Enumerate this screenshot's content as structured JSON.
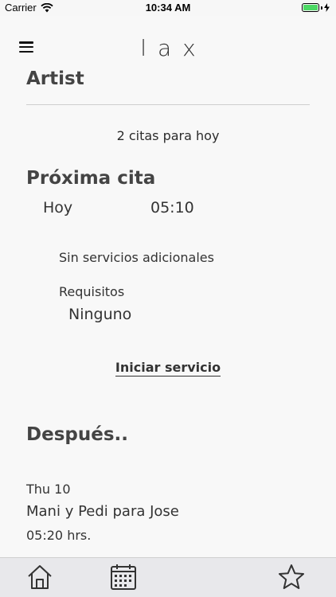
{
  "status_bar": {
    "carrier": "Carrier",
    "time": "10:34 AM"
  },
  "header": {
    "logo": "lax"
  },
  "artist": {
    "title": "Artist",
    "appointments_today": "2 citas para hoy"
  },
  "next_appointment": {
    "title": "Próxima cita",
    "day": "Hoy",
    "time": "05:10",
    "services": "Sin servicios adicionales",
    "requirements_label": "Requisitos",
    "requirements_value": "Ninguno",
    "start_button": "Iniciar servicio"
  },
  "later": {
    "title": "Después..",
    "items": [
      {
        "date": "Thu 10",
        "description": "Mani y Pedi para Jose",
        "time": "05:20 hrs."
      }
    ]
  },
  "tab_bar": {
    "icons": [
      "home-icon",
      "calendar-icon",
      "star-icon"
    ]
  },
  "colors": {
    "battery": "#4cd964",
    "tab_bar_bg": "#e8e8eb"
  }
}
